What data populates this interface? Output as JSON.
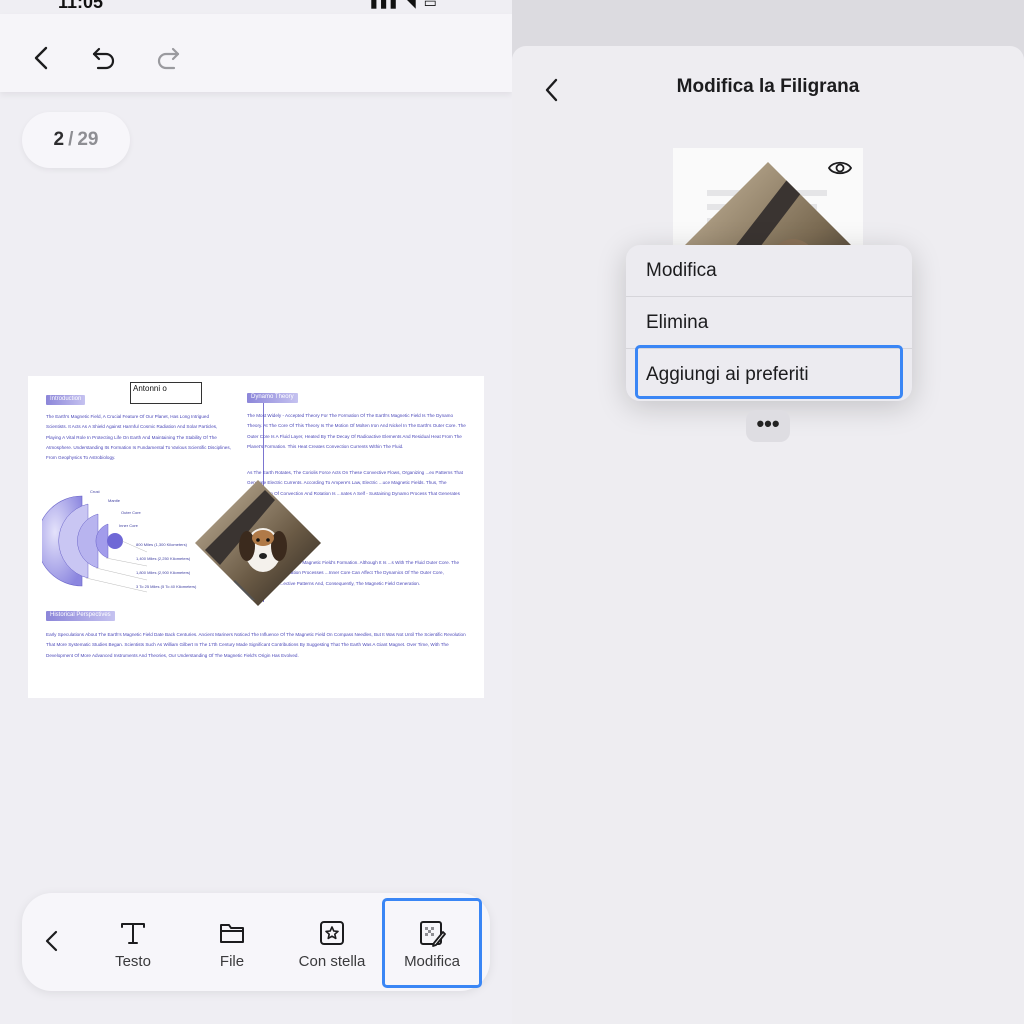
{
  "left_screen": {
    "status": {
      "time": "11:05",
      "icons": "▮▮▮ ◥ ▭"
    },
    "toolbar": {
      "back_icon": "chevron-left-icon",
      "undo_icon": "undo-icon",
      "redo_icon": "redo-icon"
    },
    "page_indicator": {
      "current": "2",
      "separator": "/",
      "total": "29"
    },
    "document": {
      "stamp_text": "Antonni o",
      "sections": {
        "intro_heading": "Introduction",
        "intro_text": "The Earth's Magnetic Field, A Crucial Feature Of Our Planet, Has Long Intrigued Scientists. It Acts As A Shield Against Harmful Cosmic Radiation And Solar Particles, Playing A Vital Role In Protecting Life On Earth And Maintaining The Stability Of The Atmosphere. Understanding Its Formation Is Fundamental To Various Scientific Disciplines, From Geophysics To Astrobiology.",
        "dynamo_heading": "Dynamo Theory",
        "dynamo_text": "The Most Widely - Accepted Theory For The Formation Of The Earth's Magnetic Field Is The Dynamo Theory. At The Core Of This Theory Is The Motion Of Molten Iron And Nickel In The Earth's Outer Core. The Outer Core Is A Fluid Layer, Heated By The Decay Of Radioactive Elements And Residual Heat From The Planet's Formation. This Heat Creates Convection Currents Within The Fluid.",
        "dynamo_text_2": "As The Earth Rotates, The Coriolis Force Acts On These Convective Flows, Organizing ...ex Patterns That Generate Electric Currents. According To Ampere's Law, Electric ...uce Magnetic Fields. Thus, The Combination Of Convection And Rotation Is ...nates A Self - Sustaining Dynamo Process That Generates The Earth's",
        "core_text": "...Also Plays A Role In The Magnetic Field's Formation. Although It Is ...s With The Fluid Outer Core. The Growth And Crystallization Processes ...Inner Core Can Affect The Dynamics Of The Outer Core, Influencing The ...ective Patterns And, Consequently, The Magnetic Field Generation.",
        "history_heading": "Historical Perspectives",
        "history_text": "Early Speculations About The Earth's Magnetic Field Date Back Centuries. Ancient Mariners Noticed The Influence Of The Magnetic Field On Compass Needles, But It Was Not Until The Scientific Revolution That More Systematic Studies Began. Scientists Such As William Gilbert In The 17th Century Made Significant Contributions By Suggesting That The Earth Was A Giant Magnet. Over Time, With The Development Of More Advanced Instruments And Theories, Our Understanding Of The Magnetic Field's Origin Has Evolved."
      },
      "diagram_labels": {
        "crust": "Crust",
        "mantle": "Mantle",
        "outer_core": "Outer Core",
        "inner_core": "Inner Core",
        "d1": "800 Miles (1,300 Kilometers)",
        "d2": "1,400 Miles (2,250 Kilometers)",
        "d3": "1,800 Miles (2,900 Kilometers)",
        "d4": "3 To 25 Miles (5 To 40 Kilometers)"
      }
    },
    "bottom_toolbar": {
      "back_icon": "chevron-left-icon",
      "items": [
        {
          "label": "Testo",
          "icon": "text-icon"
        },
        {
          "label": "File",
          "icon": "folder-icon"
        },
        {
          "label": "Con stella",
          "icon": "star-square-icon"
        },
        {
          "label": "Modifica",
          "icon": "edit-watermark-icon"
        }
      ]
    }
  },
  "right_screen": {
    "status": {
      "time": "11:05",
      "icons": "▮▮▮ ◥ ▭"
    },
    "sheet": {
      "title": "Modifica la Filigrana",
      "back_icon": "chevron-left-icon",
      "preview_icon": "eye-icon"
    },
    "context_menu": {
      "items": [
        "Modifica",
        "Elimina",
        "Aggiungi ai preferiti"
      ]
    },
    "more_button": "•••"
  },
  "colors": {
    "highlight": "#3a86f5",
    "doc_text": "#4a47b8",
    "doc_heading": "#8c86d9"
  }
}
